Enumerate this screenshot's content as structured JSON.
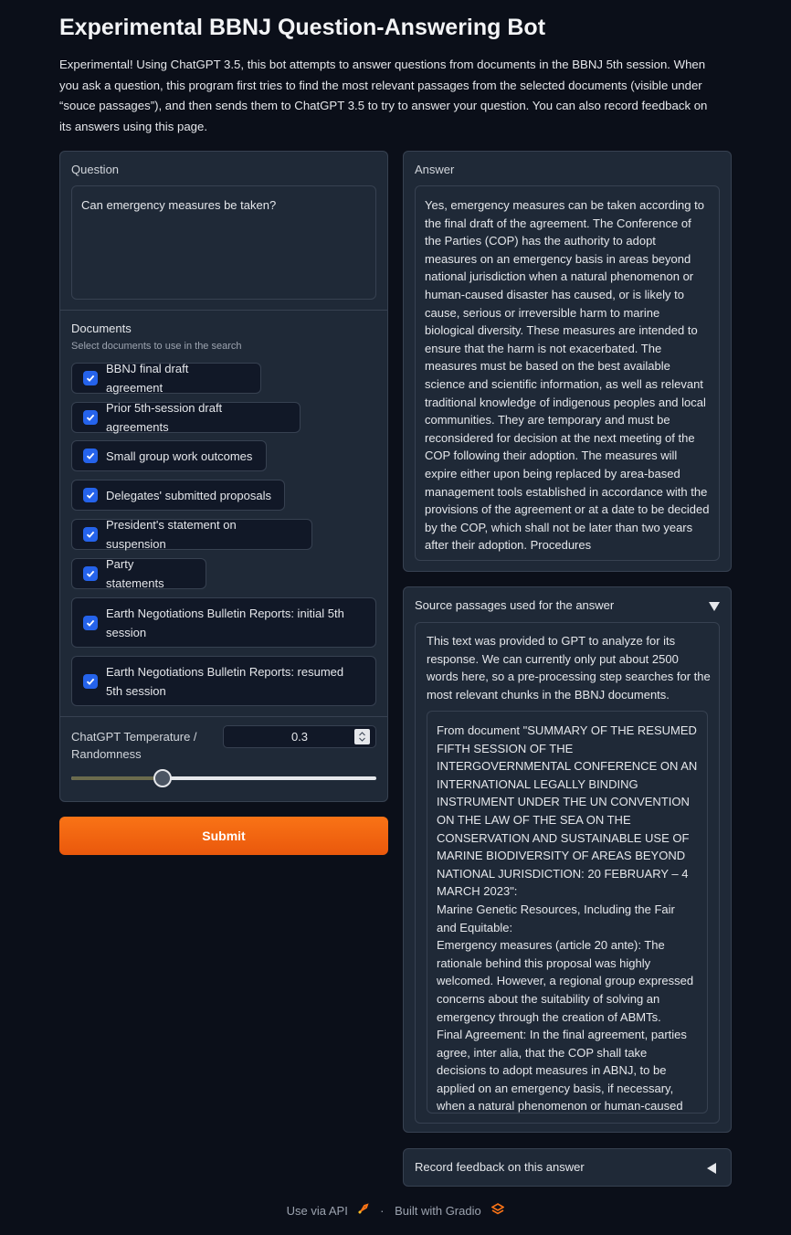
{
  "page": {
    "title": "Experimental BBNJ Question-Answering Bot",
    "intro": "Experimental! Using ChatGPT 3.5, this bot attempts to answer questions from documents in the BBNJ 5th session. When you ask a question, this program first tries to find the most relevant passages from the selected documents (visible under “souce passages”), and then sends them to ChatGPT 3.5 to try to answer your question. You can also record feedback on its answers using this page."
  },
  "question": {
    "label": "Question",
    "value": "Can emergency measures be taken?"
  },
  "documents": {
    "label": "Documents",
    "hint": "Select documents to use in the search",
    "items": [
      {
        "label": "BBNJ final draft agreement",
        "checked": true
      },
      {
        "label": "Prior 5th-session draft agreements",
        "checked": true
      },
      {
        "label": "Small group work outcomes",
        "checked": true
      },
      {
        "label": "Delegates' submitted proposals",
        "checked": true
      },
      {
        "label": "President's statement on suspension",
        "checked": true
      },
      {
        "label": "Party statements",
        "checked": true
      },
      {
        "label": "Earth Negotiations Bulletin Reports: initial 5th session",
        "checked": true
      },
      {
        "label": "Earth Negotiations Bulletin Reports: resumed 5th session",
        "checked": true
      }
    ]
  },
  "temperature": {
    "label": "ChatGPT Temperature / Randomness",
    "value": "0.3",
    "fraction": 0.3
  },
  "submit_label": "Submit",
  "answer": {
    "label": "Answer",
    "text": "Yes, emergency measures can be taken according to the final draft of the agreement. The Conference of the Parties (COP) has the authority to adopt measures on an emergency basis in areas beyond national jurisdiction when a natural phenomenon or human-caused disaster has caused, or is likely to cause, serious or irreversible harm to marine biological diversity. These measures are intended to ensure that the harm is not exacerbated. The measures must be based on the best available science and scientific information, as well as relevant traditional knowledge of indigenous peoples and local communities. They are temporary and must be reconsidered for decision at the next meeting of the COP following their adoption. The measures will expire either upon being replaced by area-based management tools established in accordance with the provisions of the agreement or at a date to be decided by the COP, which shall not be later than two years after their adoption. Procedures"
  },
  "sources": {
    "label": "Source passages used for the answer",
    "toggle_icon": "triangle-down",
    "description": "This text was provided to GPT to analyze for its response. We can currently only put about 2500 words here, so a pre-processing step searches for the most relevant chunks in the BBNJ documents.",
    "paragraphs": [
      "From document \"SUMMARY OF THE RESUMED FIFTH SESSION OF THE INTERGOVERNMENTAL CONFERENCE ON AN INTERNATIONAL LEGALLY BINDING INSTRUMENT UNDER THE UN CONVENTION ON THE LAW OF THE SEA ON THE CONSERVATION AND SUSTAINABLE USE OF MARINE BIODIVERSITY OF AREAS BEYOND NATIONAL JURISDICTION: 20 FEBRUARY – 4 MARCH 2023\":",
      "Marine Genetic Resources, Including the Fair and Equitable:",
      "Emergency measures (article 20 ante): The rationale behind this proposal was highly welcomed. However, a regional group expressed concerns about the suitability of solving an emergency through the creation of ABMTs.",
      "Final Agreement: In the final agreement, parties agree, inter alia, that the COP shall take decisions to adopt measures in ABNJ, to be applied on an emergency basis, if necessary, when a natural phenomenon or human-caused disaster has caused, or is likely to cause, serious"
    ]
  },
  "feedback": {
    "label": "Record feedback on this answer",
    "toggle_icon": "triangle-left"
  },
  "footer": {
    "api_label": "Use via API",
    "separator": "·",
    "built_label": "Built with Gradio"
  }
}
